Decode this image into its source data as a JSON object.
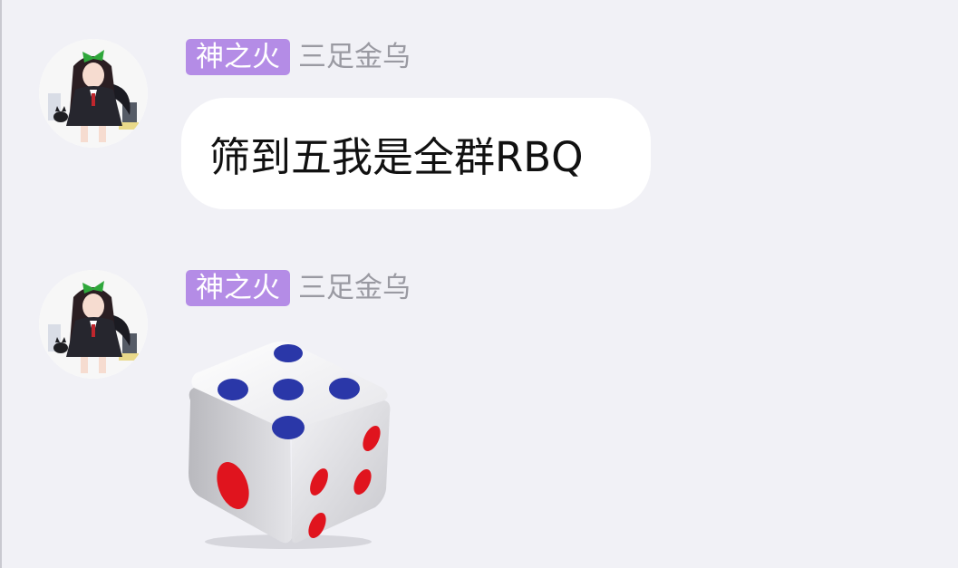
{
  "messages": [
    {
      "sender_title": "神之火",
      "sender_name": "三足金乌",
      "type": "text",
      "text": "筛到五我是全群RBQ"
    },
    {
      "sender_title": "神之火",
      "sender_name": "三足金乌",
      "type": "dice",
      "dice_top_face": 5,
      "dice_colors": {
        "top_pips": "#2a37a8",
        "side_pips": "#e0141e"
      }
    }
  ],
  "colors": {
    "background": "#f1f1f6",
    "title_badge": "#b48ce6",
    "bubble": "#ffffff",
    "nickname": "#9a9aa2"
  }
}
